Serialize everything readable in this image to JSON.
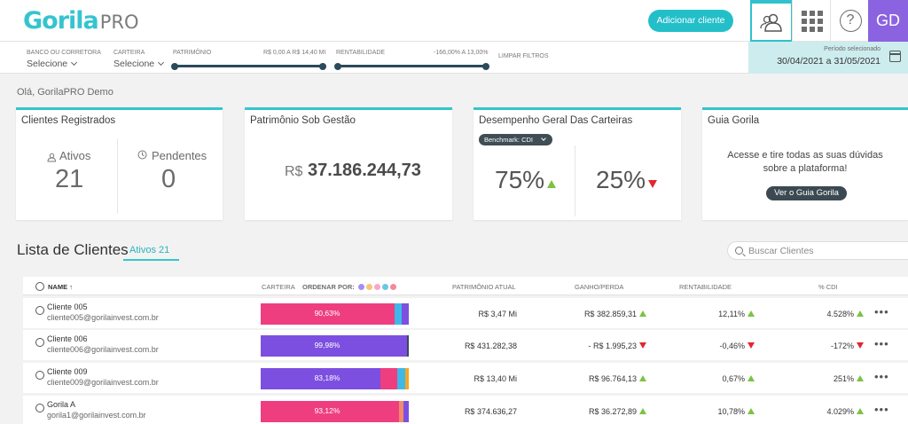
{
  "header": {
    "logo_main": "Gorila",
    "logo_sub": "PRO",
    "add_client": "Adicionar cliente",
    "avatar": "GD",
    "help": "?"
  },
  "filters": {
    "bank_label": "BANCO OU CORRETORA",
    "bank_value": "Selecione",
    "wallet_label": "CARTEIRA",
    "wallet_value": "Selecione",
    "patrimonio_label": "PATRIMÔNIO",
    "patrimonio_range": "R$ 0,00 A R$ 14,40 MI",
    "rent_label": "RENTABILIDADE",
    "rent_range": "-166,00% A 13,00%",
    "clear": "LIMPAR FILTROS",
    "period_label": "Período selecionado",
    "period_value": "30/04/2021 a 31/05/2021"
  },
  "greeting": "Olá, GorilaPRO Demo",
  "cards": {
    "clients": {
      "title": "Clientes Registrados",
      "active_label": "Ativos",
      "active_value": "21",
      "pending_label": "Pendentes",
      "pending_value": "0"
    },
    "patrimonio": {
      "title": "Patrimônio Sob Gestão",
      "currency": "R$",
      "value": "37.186.244,73"
    },
    "performance": {
      "title": "Desempenho Geral Das Carteiras",
      "benchmark": "Benchmark: CDI",
      "up_value": "75%",
      "down_value": "25%"
    },
    "guide": {
      "title": "Guia Gorila",
      "text_line1": "Acesse e tire todas as suas dúvidas",
      "text_line2": "sobre a plataforma!",
      "button": "Ver o Guia Gorila"
    }
  },
  "list": {
    "title": "Lista de Clientes",
    "tab_label": "Ativos",
    "tab_count": "21",
    "search_placeholder": "Buscar Clientes",
    "columns": {
      "name": "NAME",
      "sort": "↑",
      "carteira": "CARTEIRA",
      "order_by": "ORDENAR POR:",
      "patrimonio": "PATRIMÔNIO ATUAL",
      "ganho": "GANHO/PERDA",
      "rent": "RENTABILIDADE",
      "cdi": "% CDI"
    },
    "order_colors": [
      "#a58ef0",
      "#f5c67a",
      "#f7a8c9",
      "#69c9e0",
      "#f28a9a"
    ],
    "rows": [
      {
        "name": "Cliente 005",
        "email": "cliente005@gorilainvest.com.br",
        "bar_label": "90,63%",
        "segments": [
          {
            "color": "#ee3e80",
            "pct": 90.63
          },
          {
            "color": "#3fb8e8",
            "pct": 4.5
          },
          {
            "color": "#7c4fe0",
            "pct": 4.87
          }
        ],
        "patrimonio": "R$ 3,47 Mi",
        "ganho": "R$ 382.859,31",
        "ganho_dir": "up",
        "rent": "12,11%",
        "rent_dir": "up",
        "cdi": "4.528%",
        "cdi_dir": "up"
      },
      {
        "name": "Cliente 006",
        "email": "cliente006@gorilainvest.com.br",
        "bar_label": "99,98%",
        "segments": [
          {
            "color": "#7c4fe0",
            "pct": 99.0
          },
          {
            "color": "#3a4a5a",
            "pct": 1.0
          }
        ],
        "patrimonio": "R$ 431.282,38",
        "ganho": "- R$ 1.995,23",
        "ganho_dir": "down",
        "rent": "-0,46%",
        "rent_dir": "down",
        "cdi": "-172%",
        "cdi_dir": "down"
      },
      {
        "name": "Cliente 009",
        "email": "cliente009@gorilainvest.com.br",
        "bar_label": "83,18%",
        "segments": [
          {
            "color": "#7c4fe0",
            "pct": 81.0
          },
          {
            "color": "#ee3e80",
            "pct": 11.0
          },
          {
            "color": "#3fb8e8",
            "pct": 5.5
          },
          {
            "color": "#f5a623",
            "pct": 2.5
          }
        ],
        "patrimonio": "R$ 13,40 Mi",
        "ganho": "R$ 96.764,13",
        "ganho_dir": "up",
        "rent": "0,67%",
        "rent_dir": "up",
        "cdi": "251%",
        "cdi_dir": "up"
      },
      {
        "name": "Gorila A",
        "email": "gorila1@gorilainvest.com.br",
        "bar_label": "93,12%",
        "segments": [
          {
            "color": "#ee3e80",
            "pct": 93.12
          },
          {
            "color": "#f28a6a",
            "pct": 3.5
          },
          {
            "color": "#7c4fe0",
            "pct": 3.38
          }
        ],
        "patrimonio": "R$ 374.636,27",
        "ganho": "R$ 36.272,89",
        "ganho_dir": "up",
        "rent": "10,78%",
        "rent_dir": "up",
        "cdi": "4.029%",
        "cdi_dir": "up"
      }
    ]
  },
  "icons": {
    "users": "users-icon",
    "apps": "grid-icon",
    "help": "help-icon",
    "calendar": "calendar-icon",
    "search": "search-icon"
  },
  "colors": {
    "accent": "#23bfc9",
    "avatar": "#8b63e0",
    "positive": "#7dc242",
    "negative": "#e3262f"
  }
}
